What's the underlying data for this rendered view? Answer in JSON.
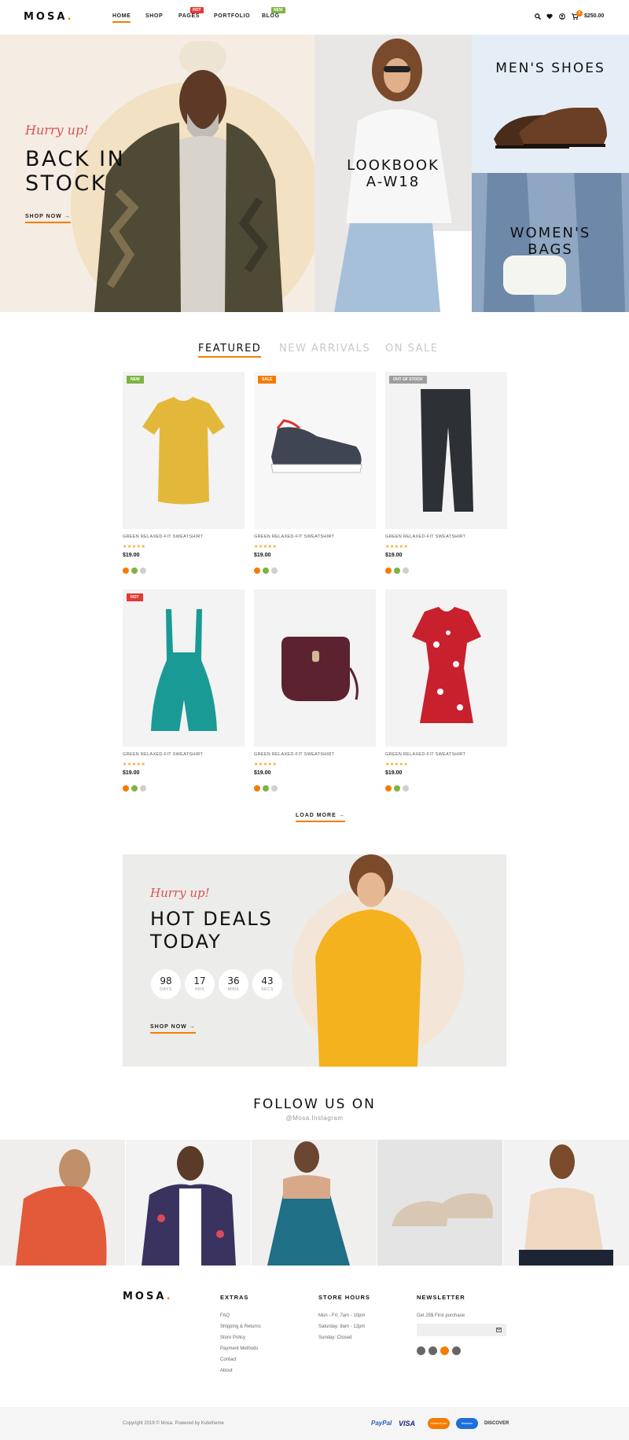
{
  "header": {
    "logo": "MOSA",
    "nav": [
      {
        "label": "HOME"
      },
      {
        "label": "SHOP"
      },
      {
        "label": "PAGES",
        "badge": "HOT"
      },
      {
        "label": "PORTFOLIO"
      },
      {
        "label": "BLOG",
        "badge": "NEW"
      }
    ],
    "cart_count": "0",
    "cart_total": "$250.00"
  },
  "hero": {
    "main": {
      "kicker": "Hurry up!",
      "title_line1": "BACK IN",
      "title_line2": "STOCK",
      "cta": "SHOP NOW"
    },
    "lookbook": {
      "line1": "LOOKBOOK",
      "line2": "A-W18"
    },
    "mens": {
      "title": "MEN'S SHOES"
    },
    "womens": {
      "line1": "WOMEN'S",
      "line2": "BAGS"
    }
  },
  "tabs": [
    "FEATURED",
    "NEW ARRIVALS",
    "ON SALE"
  ],
  "products": [
    {
      "tag": "NEW",
      "tag_color": "#7cb342",
      "name": "GREEN RELAXED-FIT SWEATSHIRT",
      "stars": "★★★★★",
      "price": "$19.00"
    },
    {
      "tag": "SALE",
      "tag_color": "#f57c00",
      "name": "GREEN RELAXED-FIT SWEATSHIRT",
      "stars": "★★★★★",
      "price": "$19.00"
    },
    {
      "tag": "OUT OF STOCK",
      "tag_color": "#9e9e9e",
      "name": "GREEN RELAXED-FIT SWEATSHIRT",
      "stars": "★★★★★",
      "price": "$19.00"
    },
    {
      "tag": "HOT",
      "tag_color": "#e53935",
      "name": "GREEN RELAXED-FIT SWEATSHIRT",
      "stars": "★★★★★",
      "price": "$19.00"
    },
    {
      "tag": "",
      "tag_color": "",
      "name": "GREEN RELAXED-FIT SWEATSHIRT",
      "stars": "★★★★★",
      "price": "$19.00"
    },
    {
      "tag": "",
      "tag_color": "",
      "name": "GREEN RELAXED-FIT SWEATSHIRT",
      "stars": "★★★★★",
      "price": "$19.00"
    }
  ],
  "swatch_colors": [
    "#f57c00",
    "#7cb342",
    "#cfcfcf"
  ],
  "load_more": "LOAD MORE",
  "deal": {
    "kicker": "Hurry up!",
    "title_line1": "HOT DEALS",
    "title_line2": "TODAY",
    "countdown": [
      {
        "value": "98",
        "label": "DAYS"
      },
      {
        "value": "17",
        "label": "HRS"
      },
      {
        "value": "36",
        "label": "MINS"
      },
      {
        "value": "43",
        "label": "SECS"
      }
    ],
    "cta": "SHOP NOW"
  },
  "follow": {
    "title": "FOLLOW US ON",
    "handle": "@Mosa.Instagram"
  },
  "footer": {
    "logo": "MOSA",
    "extras": {
      "title": "EXTRAS",
      "items": [
        "FAQ",
        "Shipping & Returns",
        "Store Policy",
        "Payment Methods",
        "Contact",
        "About"
      ]
    },
    "hours": {
      "title": "STORE HOURS",
      "items": [
        "Mon - Fri: 7am - 10pm",
        "Saturday: 8am - 12pm",
        "Sunday: Closed"
      ]
    },
    "newsletter": {
      "title": "NEWSLETTER",
      "subtitle": "Get 25$ First purchase",
      "placeholder": ""
    },
    "copyright": "Copyright 2019 © Mosa. Powered by Kutetheme",
    "payments": [
      "PayPal",
      "VISA",
      "MasterCard",
      "Maestro",
      "DISCOVER"
    ]
  },
  "colors": {
    "accent": "#f57c00",
    "hero_bg": "#f5ede4",
    "deal_bg": "#ececea",
    "footer_bottom": "#f5f5f5"
  }
}
